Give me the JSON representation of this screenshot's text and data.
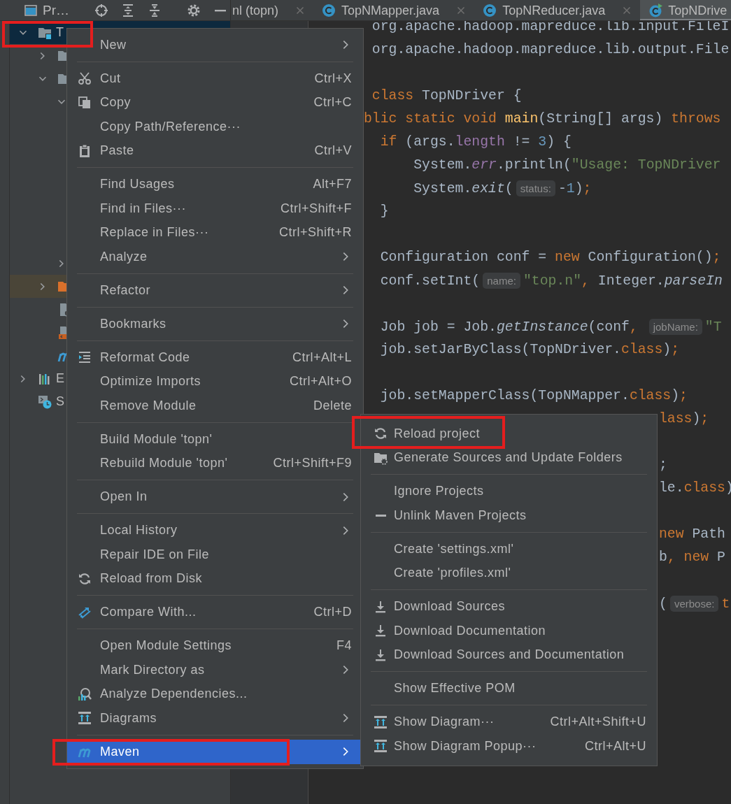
{
  "project_panel": {
    "title": "Pr…"
  },
  "tabs": [
    {
      "label": "nl (topn)",
      "kind": "plain",
      "selected": false,
      "closable": true
    },
    {
      "label": "TopNMapper.java",
      "kind": "class",
      "selected": false,
      "closable": true
    },
    {
      "label": "TopNReducer.java",
      "kind": "class",
      "selected": false,
      "closable": true
    },
    {
      "label": "TopNDrive",
      "kind": "run-class",
      "selected": true,
      "closable": false
    }
  ],
  "tree": [
    {
      "label": "T",
      "kind": "module",
      "expanded": true,
      "selected": true,
      "highlighted": false,
      "framed": true,
      "children": [
        {
          "kind": "folder",
          "expanded": false,
          "selected": false,
          "highlighted": false,
          "framed": false
        },
        {
          "kind": "folder",
          "expanded": true,
          "selected": false,
          "highlighted": false,
          "framed": false,
          "children": [
            {
              "expanded": true,
              "selected": false,
              "highlighted": false,
              "framed": false
            },
            {
              "expanded": false,
              "selected": false,
              "highlighted": false,
              "framed": false
            }
          ]
        },
        {
          "kind": "excluded-folder",
          "expanded": false,
          "selected": false,
          "highlighted": true,
          "framed": false
        },
        {
          "kind": "settings-file",
          "selected": false,
          "highlighted": false,
          "framed": false
        },
        {
          "kind": "xml-file",
          "selected": false,
          "highlighted": false,
          "framed": false
        },
        {
          "kind": "maven-file",
          "selected": false,
          "highlighted": false,
          "framed": false
        }
      ]
    },
    {
      "label": "E",
      "kind": "libraries",
      "expanded": false,
      "selected": false,
      "highlighted": false,
      "framed": false
    },
    {
      "label": "S",
      "kind": "scratches",
      "selected": false,
      "highlighted": false,
      "framed": false
    }
  ],
  "editor": {
    "blocks": [
      {
        "lines": [
          {
            "segments": [
              {
                "text": " org.apache.hadoop.mapreduce.lib.input.FileI",
                "kind": "plain"
              }
            ]
          },
          {
            "segments": [
              {
                "text": " org.apache.hadoop.mapreduce.lib.output.File",
                "kind": "plain"
              }
            ]
          }
        ]
      },
      {
        "lines": [
          {
            "segments": [
              {
                "text": " class",
                "kind": "keyword"
              },
              {
                "text": " TopNDriver {",
                "kind": "plain"
              }
            ]
          },
          {
            "segments": [
              {
                "text": "blic static void ",
                "kind": "keyword"
              },
              {
                "text": "main",
                "kind": "method"
              },
              {
                "text": "(String[] args) ",
                "kind": "plain"
              },
              {
                "text": "throws",
                "kind": "keyword"
              }
            ]
          },
          {
            "segments": [
              {
                "text": "  if",
                "kind": "keyword"
              },
              {
                "text": " (args.",
                "kind": "plain"
              },
              {
                "text": "length",
                "kind": "field"
              },
              {
                "text": " != ",
                "kind": "plain"
              },
              {
                "text": "3",
                "kind": "number"
              },
              {
                "text": ") {",
                "kind": "plain"
              }
            ]
          },
          {
            "segments": [
              {
                "text": "      System.",
                "kind": "plain"
              },
              {
                "text": "err",
                "kind": "static-field"
              },
              {
                "text": ".println(",
                "kind": "plain"
              },
              {
                "text": "\"Usage: TopNDriver",
                "kind": "string"
              }
            ]
          },
          {
            "segments": [
              {
                "text": "      System.",
                "kind": "plain"
              },
              {
                "text": "exit",
                "kind": "static"
              },
              {
                "text": "(",
                "kind": "plain"
              },
              {
                "text": "status:",
                "kind": "hint"
              },
              {
                "text": "-",
                "kind": "plain"
              },
              {
                "text": "1",
                "kind": "number"
              },
              {
                "text": ")",
                "kind": "plain"
              },
              {
                "text": ";",
                "kind": "keyword"
              }
            ]
          },
          {
            "segments": [
              {
                "text": "  }",
                "kind": "plain"
              }
            ]
          }
        ]
      },
      {
        "lines": [
          {
            "segments": [
              {
                "text": "  Configuration conf = ",
                "kind": "plain"
              },
              {
                "text": "new",
                "kind": "keyword"
              },
              {
                "text": " Configuration()",
                "kind": "plain"
              },
              {
                "text": ";",
                "kind": "keyword"
              }
            ]
          },
          {
            "segments": [
              {
                "text": "  conf.setInt(",
                "kind": "plain"
              },
              {
                "text": "name:",
                "kind": "hint"
              },
              {
                "text": "\"top.n\"",
                "kind": "string"
              },
              {
                "text": ",",
                "kind": "keyword"
              },
              {
                "text": " Integer.",
                "kind": "plain"
              },
              {
                "text": "parseIn",
                "kind": "static"
              }
            ]
          }
        ]
      },
      {
        "lines": [
          {
            "segments": [
              {
                "text": "  Job job = Job.",
                "kind": "plain"
              },
              {
                "text": "getInstance",
                "kind": "static"
              },
              {
                "text": "(conf",
                "kind": "plain"
              },
              {
                "text": ", ",
                "kind": "keyword"
              },
              {
                "text": "jobName:",
                "kind": "hint"
              },
              {
                "text": "\"T",
                "kind": "string"
              }
            ]
          },
          {
            "segments": [
              {
                "text": "  job.setJarByClass(TopNDriver.",
                "kind": "plain"
              },
              {
                "text": "class",
                "kind": "keyword"
              },
              {
                "text": ")",
                "kind": "plain"
              },
              {
                "text": ";",
                "kind": "keyword"
              }
            ]
          }
        ]
      },
      {
        "lines": [
          {
            "segments": [
              {
                "text": "  job.setMapperClass(TopNMapper.",
                "kind": "plain"
              },
              {
                "text": "class",
                "kind": "keyword"
              },
              {
                "text": ")",
                "kind": "plain"
              },
              {
                "text": ";",
                "kind": "keyword"
              }
            ]
          }
        ]
      }
    ],
    "beside_submenu": {
      "blocks": [
        {
          "lines": [
            {
              "segments": [
                {
                  "text": "lass",
                  "kind": "keyword"
                },
                {
                  "text": ")",
                  "kind": "plain"
                },
                {
                  "text": ";",
                  "kind": "keyword"
                }
              ]
            }
          ]
        },
        {
          "lines": [
            {
              "segments": [
                {
                  "text": ";",
                  "kind": "plain"
                }
              ]
            },
            {
              "segments": [
                {
                  "text": "le.",
                  "kind": "plain"
                },
                {
                  "text": "class",
                  "kind": "keyword"
                },
                {
                  "text": ")",
                  "kind": "plain"
                }
              ]
            }
          ]
        },
        {
          "lines": [
            {
              "segments": [
                {
                  "text": "new",
                  "kind": "keyword"
                },
                {
                  "text": " Path",
                  "kind": "plain"
                }
              ]
            },
            {
              "segments": [
                {
                  "text": "b",
                  "kind": "plain"
                },
                {
                  "text": ", new",
                  "kind": "keyword"
                },
                {
                  "text": " P",
                  "kind": "plain"
                }
              ]
            }
          ]
        },
        {
          "lines": [
            {
              "segments": [
                {
                  "text": "(",
                  "kind": "plain"
                },
                {
                  "text": "verbose:",
                  "kind": "hint"
                },
                {
                  "text": "t",
                  "kind": "keyword"
                }
              ]
            }
          ]
        }
      ]
    }
  },
  "context_menu": {
    "items": [
      {
        "kind": "item",
        "label": "New",
        "submenu": true,
        "selected": false,
        "framed": false
      },
      {
        "kind": "separator"
      },
      {
        "kind": "item",
        "label": "Cut",
        "shortcut": "Ctrl+X",
        "selected": false,
        "framed": false
      },
      {
        "kind": "item",
        "label": "Copy",
        "shortcut": "Ctrl+C",
        "selected": false,
        "framed": false
      },
      {
        "kind": "item",
        "label": "Copy Path/Reference···",
        "selected": false,
        "framed": false
      },
      {
        "kind": "item",
        "label": "Paste",
        "shortcut": "Ctrl+V",
        "selected": false,
        "framed": false
      },
      {
        "kind": "separator"
      },
      {
        "kind": "item",
        "label": "Find Usages",
        "shortcut": "Alt+F7",
        "selected": false,
        "framed": false
      },
      {
        "kind": "item",
        "label": "Find in Files···",
        "shortcut": "Ctrl+Shift+F",
        "selected": false,
        "framed": false
      },
      {
        "kind": "item",
        "label": "Replace in Files···",
        "shortcut": "Ctrl+Shift+R",
        "selected": false,
        "framed": false
      },
      {
        "kind": "item",
        "label": "Analyze",
        "submenu": true,
        "selected": false,
        "framed": false
      },
      {
        "kind": "separator"
      },
      {
        "kind": "item",
        "label": "Refactor",
        "submenu": true,
        "selected": false,
        "framed": false
      },
      {
        "kind": "separator"
      },
      {
        "kind": "item",
        "label": "Bookmarks",
        "submenu": true,
        "selected": false,
        "framed": false
      },
      {
        "kind": "separator"
      },
      {
        "kind": "item",
        "label": "Reformat Code",
        "shortcut": "Ctrl+Alt+L",
        "selected": false,
        "framed": false
      },
      {
        "kind": "item",
        "label": "Optimize Imports",
        "shortcut": "Ctrl+Alt+O",
        "selected": false,
        "framed": false
      },
      {
        "kind": "item",
        "label": "Remove Module",
        "shortcut": "Delete",
        "selected": false,
        "framed": false
      },
      {
        "kind": "separator"
      },
      {
        "kind": "item",
        "label": "Build Module 'topn'",
        "selected": false,
        "framed": false
      },
      {
        "kind": "item",
        "label": "Rebuild Module 'topn'",
        "shortcut": "Ctrl+Shift+F9",
        "selected": false,
        "framed": false
      },
      {
        "kind": "separator"
      },
      {
        "kind": "item",
        "label": "Open In",
        "submenu": true,
        "selected": false,
        "framed": false
      },
      {
        "kind": "separator"
      },
      {
        "kind": "item",
        "label": "Local History",
        "submenu": true,
        "selected": false,
        "framed": false
      },
      {
        "kind": "item",
        "label": "Repair IDE on File",
        "selected": false,
        "framed": false
      },
      {
        "kind": "item",
        "label": "Reload from Disk",
        "selected": false,
        "framed": false
      },
      {
        "kind": "separator"
      },
      {
        "kind": "item",
        "label": "Compare With...",
        "shortcut": "Ctrl+D",
        "selected": false,
        "framed": false
      },
      {
        "kind": "separator"
      },
      {
        "kind": "item",
        "label": "Open Module Settings",
        "shortcut": "F4",
        "selected": false,
        "framed": false
      },
      {
        "kind": "item",
        "label": "Mark Directory as",
        "submenu": true,
        "selected": false,
        "framed": false
      },
      {
        "kind": "item",
        "label": "Analyze Dependencies...",
        "selected": false,
        "framed": false
      },
      {
        "kind": "item",
        "label": "Diagrams",
        "submenu": true,
        "selected": false,
        "framed": false
      },
      {
        "kind": "separator"
      },
      {
        "kind": "item",
        "label": "Maven",
        "submenu": true,
        "selected": true,
        "framed": true
      }
    ]
  },
  "maven_submenu": {
    "items": [
      {
        "kind": "item",
        "label": "Reload project",
        "selected": false,
        "framed": true
      },
      {
        "kind": "item",
        "label": "Generate Sources and Update Folders",
        "selected": false,
        "framed": false
      },
      {
        "kind": "separator"
      },
      {
        "kind": "item",
        "label": "Ignore Projects",
        "selected": false,
        "framed": false
      },
      {
        "kind": "item",
        "label": "Unlink Maven Projects",
        "selected": false,
        "framed": false
      },
      {
        "kind": "separator"
      },
      {
        "kind": "item",
        "label": "Create 'settings.xml'",
        "selected": false,
        "framed": false
      },
      {
        "kind": "item",
        "label": "Create 'profiles.xml'",
        "selected": false,
        "framed": false
      },
      {
        "kind": "separator"
      },
      {
        "kind": "item",
        "label": "Download Sources",
        "selected": false,
        "framed": false
      },
      {
        "kind": "item",
        "label": "Download Documentation",
        "selected": false,
        "framed": false
      },
      {
        "kind": "item",
        "label": "Download Sources and Documentation",
        "selected": false,
        "framed": false
      },
      {
        "kind": "separator"
      },
      {
        "kind": "item",
        "label": "Show Effective POM",
        "selected": false,
        "framed": false
      },
      {
        "kind": "separator"
      },
      {
        "kind": "item",
        "label": "Show Diagram···",
        "shortcut": "Ctrl+Alt+Shift+U",
        "selected": false,
        "framed": false
      },
      {
        "kind": "item",
        "label": "Show Diagram Popup···",
        "shortcut": "Ctrl+Alt+U",
        "selected": false,
        "framed": false
      }
    ]
  }
}
